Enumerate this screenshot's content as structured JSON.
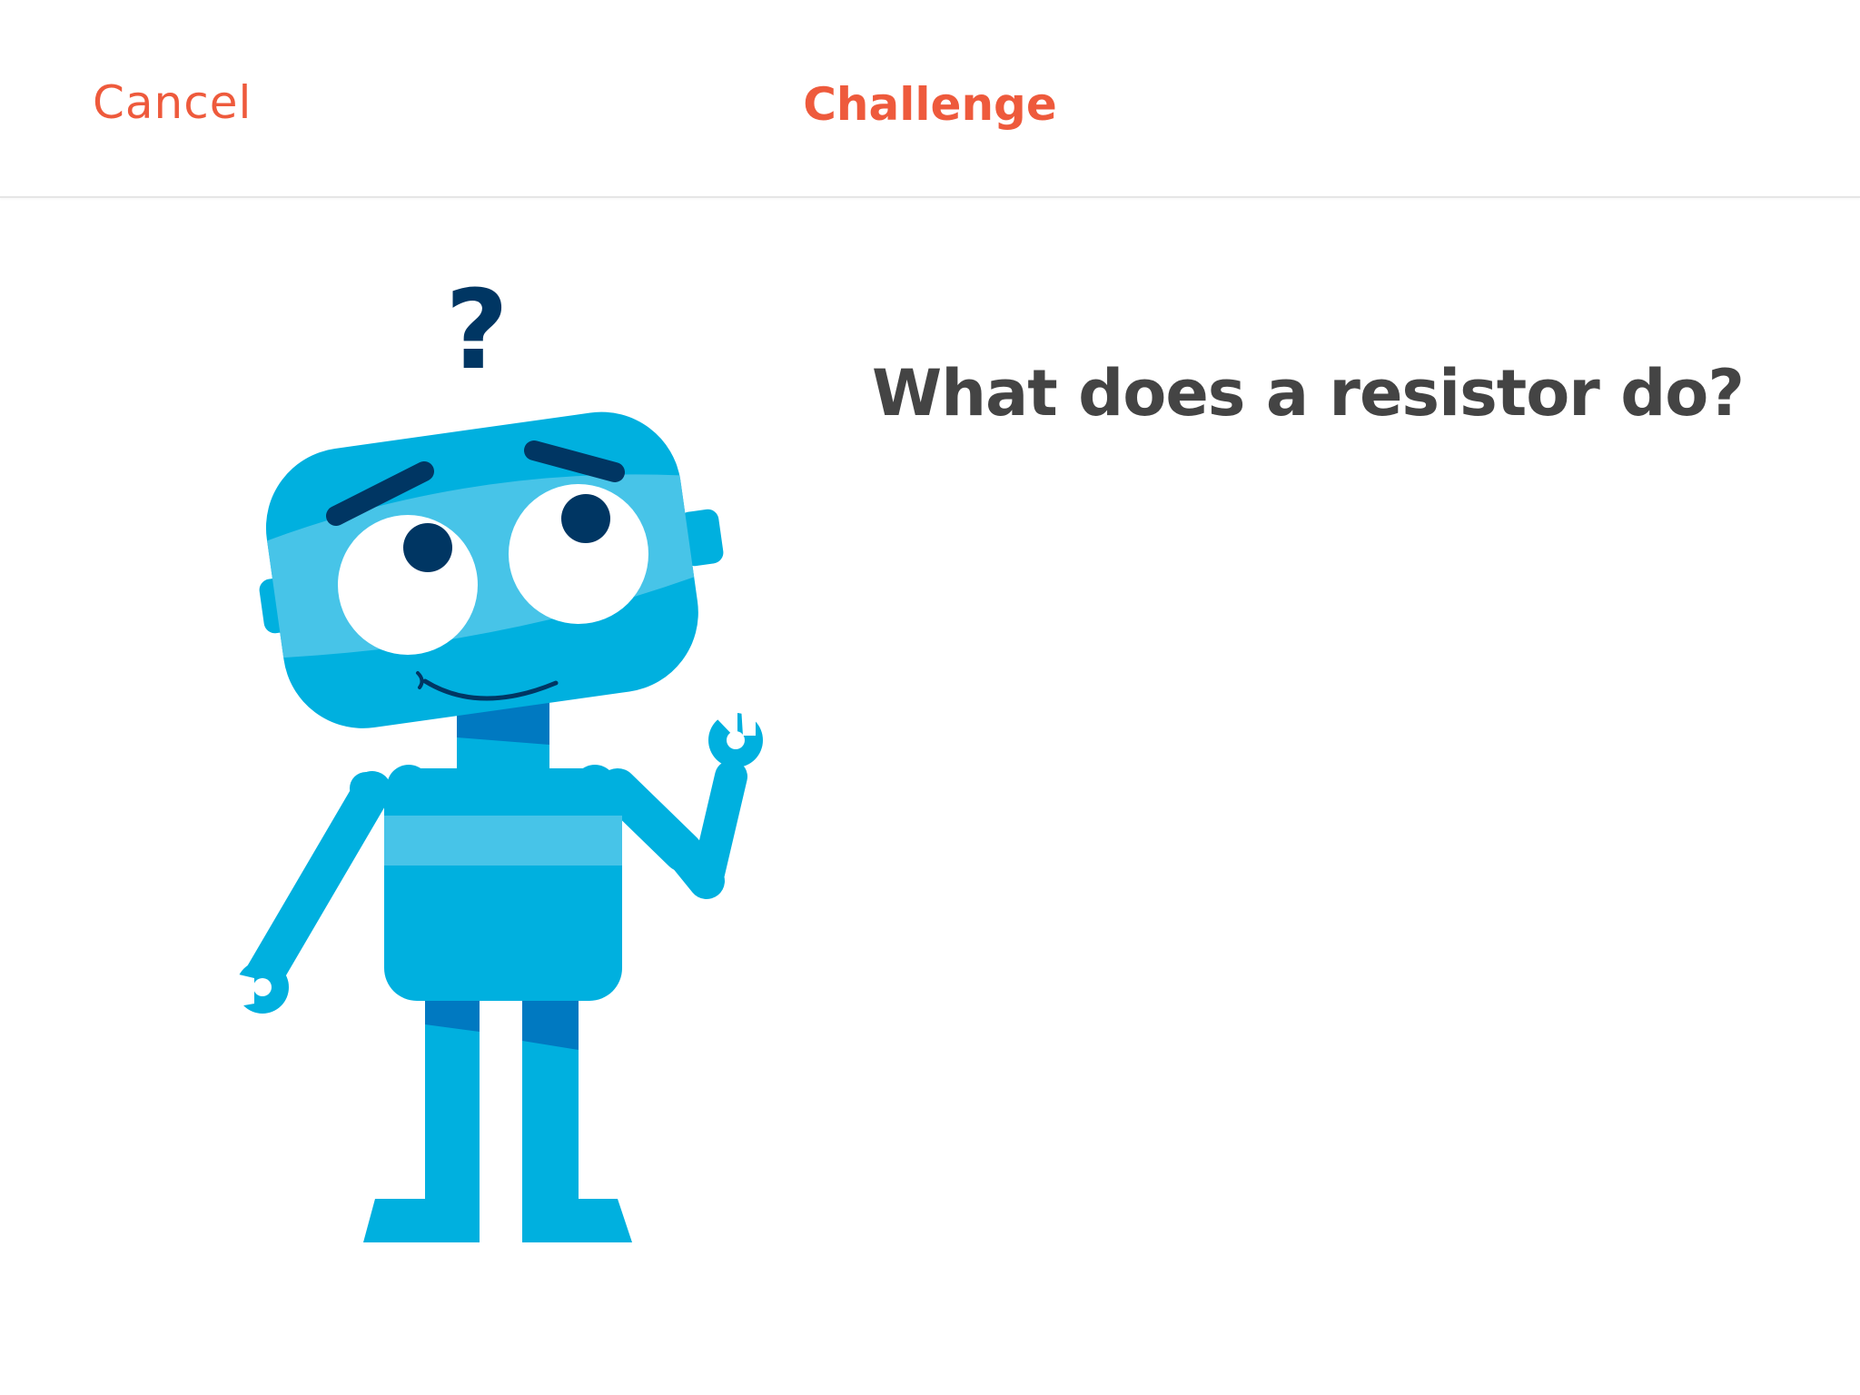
{
  "nav": {
    "cancel_label": "Cancel",
    "title": "Challenge"
  },
  "question": {
    "text": "What does a resistor do?",
    "symbol": "?"
  },
  "colors": {
    "accent": "#ee5a3c",
    "question_text": "#444444",
    "robot_primary": "#00b0df",
    "robot_light": "#47c4e8",
    "robot_dark": "#0079c1",
    "robot_features": "#003663"
  },
  "illustration": {
    "icon": "confused-robot-icon"
  }
}
